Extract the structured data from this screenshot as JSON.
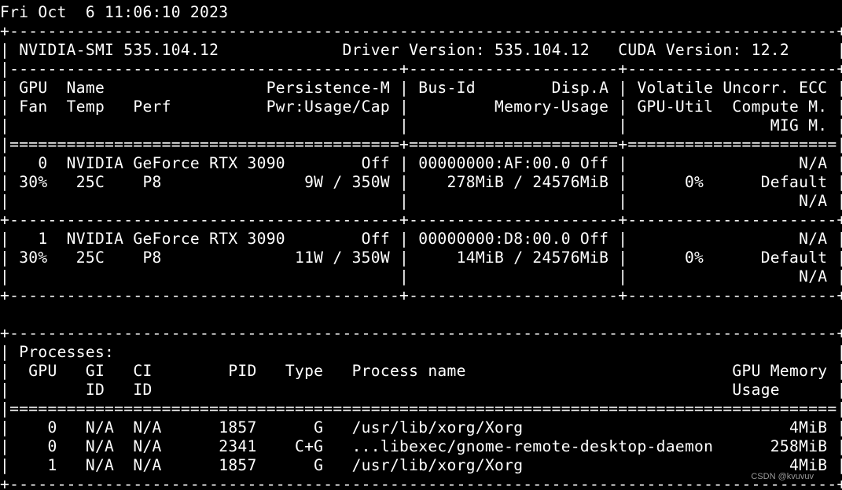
{
  "terminal": {
    "lines": [
      "Fri Oct  6 11:06:10 2023",
      "+---------------------------------------------------------------------------------------+",
      "| NVIDIA-SMI 535.104.12             Driver Version: 535.104.12   CUDA Version: 12.2     |",
      "|-----------------------------------------+----------------------+----------------------+",
      "| GPU  Name                 Persistence-M | Bus-Id        Disp.A | Volatile Uncorr. ECC |",
      "| Fan  Temp   Perf          Pwr:Usage/Cap |         Memory-Usage | GPU-Util  Compute M. |",
      "|                                         |                      |               MIG M. |",
      "|=========================================+======================+======================|",
      "|   0  NVIDIA GeForce RTX 3090        Off | 00000000:AF:00.0 Off |                  N/A |",
      "| 30%   25C    P8               9W / 350W |    278MiB / 24576MiB |      0%      Default |",
      "|                                         |                      |                  N/A |",
      "+-----------------------------------------+----------------------+----------------------+",
      "|   1  NVIDIA GeForce RTX 3090        Off | 00000000:D8:00.0 Off |                  N/A |",
      "| 30%   25C    P8              11W / 350W |     14MiB / 24576MiB |      0%      Default |",
      "|                                         |                      |                  N/A |",
      "+-----------------------------------------+----------------------+----------------------+",
      "",
      "",
      "+---------------------------------------------------------------------------------------+",
      "| Processes:                                                                            |",
      "|  GPU   GI   CI        PID   Type   Process name                            GPU Memory |",
      "|        ID   ID                                                             Usage      |",
      "|=======================================================================================|",
      "|    0   N/A  N/A      1857      G   /usr/lib/xorg/Xorg                            4MiB |",
      "|    0   N/A  N/A      2341    C+G   ...libexec/gnome-remote-desktop-daemon      258MiB |",
      "|    1   N/A  N/A      1857      G   /usr/lib/xorg/Xorg                            4MiB |",
      "+---------------------------------------------------------------------------------------+"
    ]
  },
  "watermark": "CSDN @kvuvuv",
  "colors": {
    "background": "#000000",
    "foreground": "#ffffff"
  }
}
